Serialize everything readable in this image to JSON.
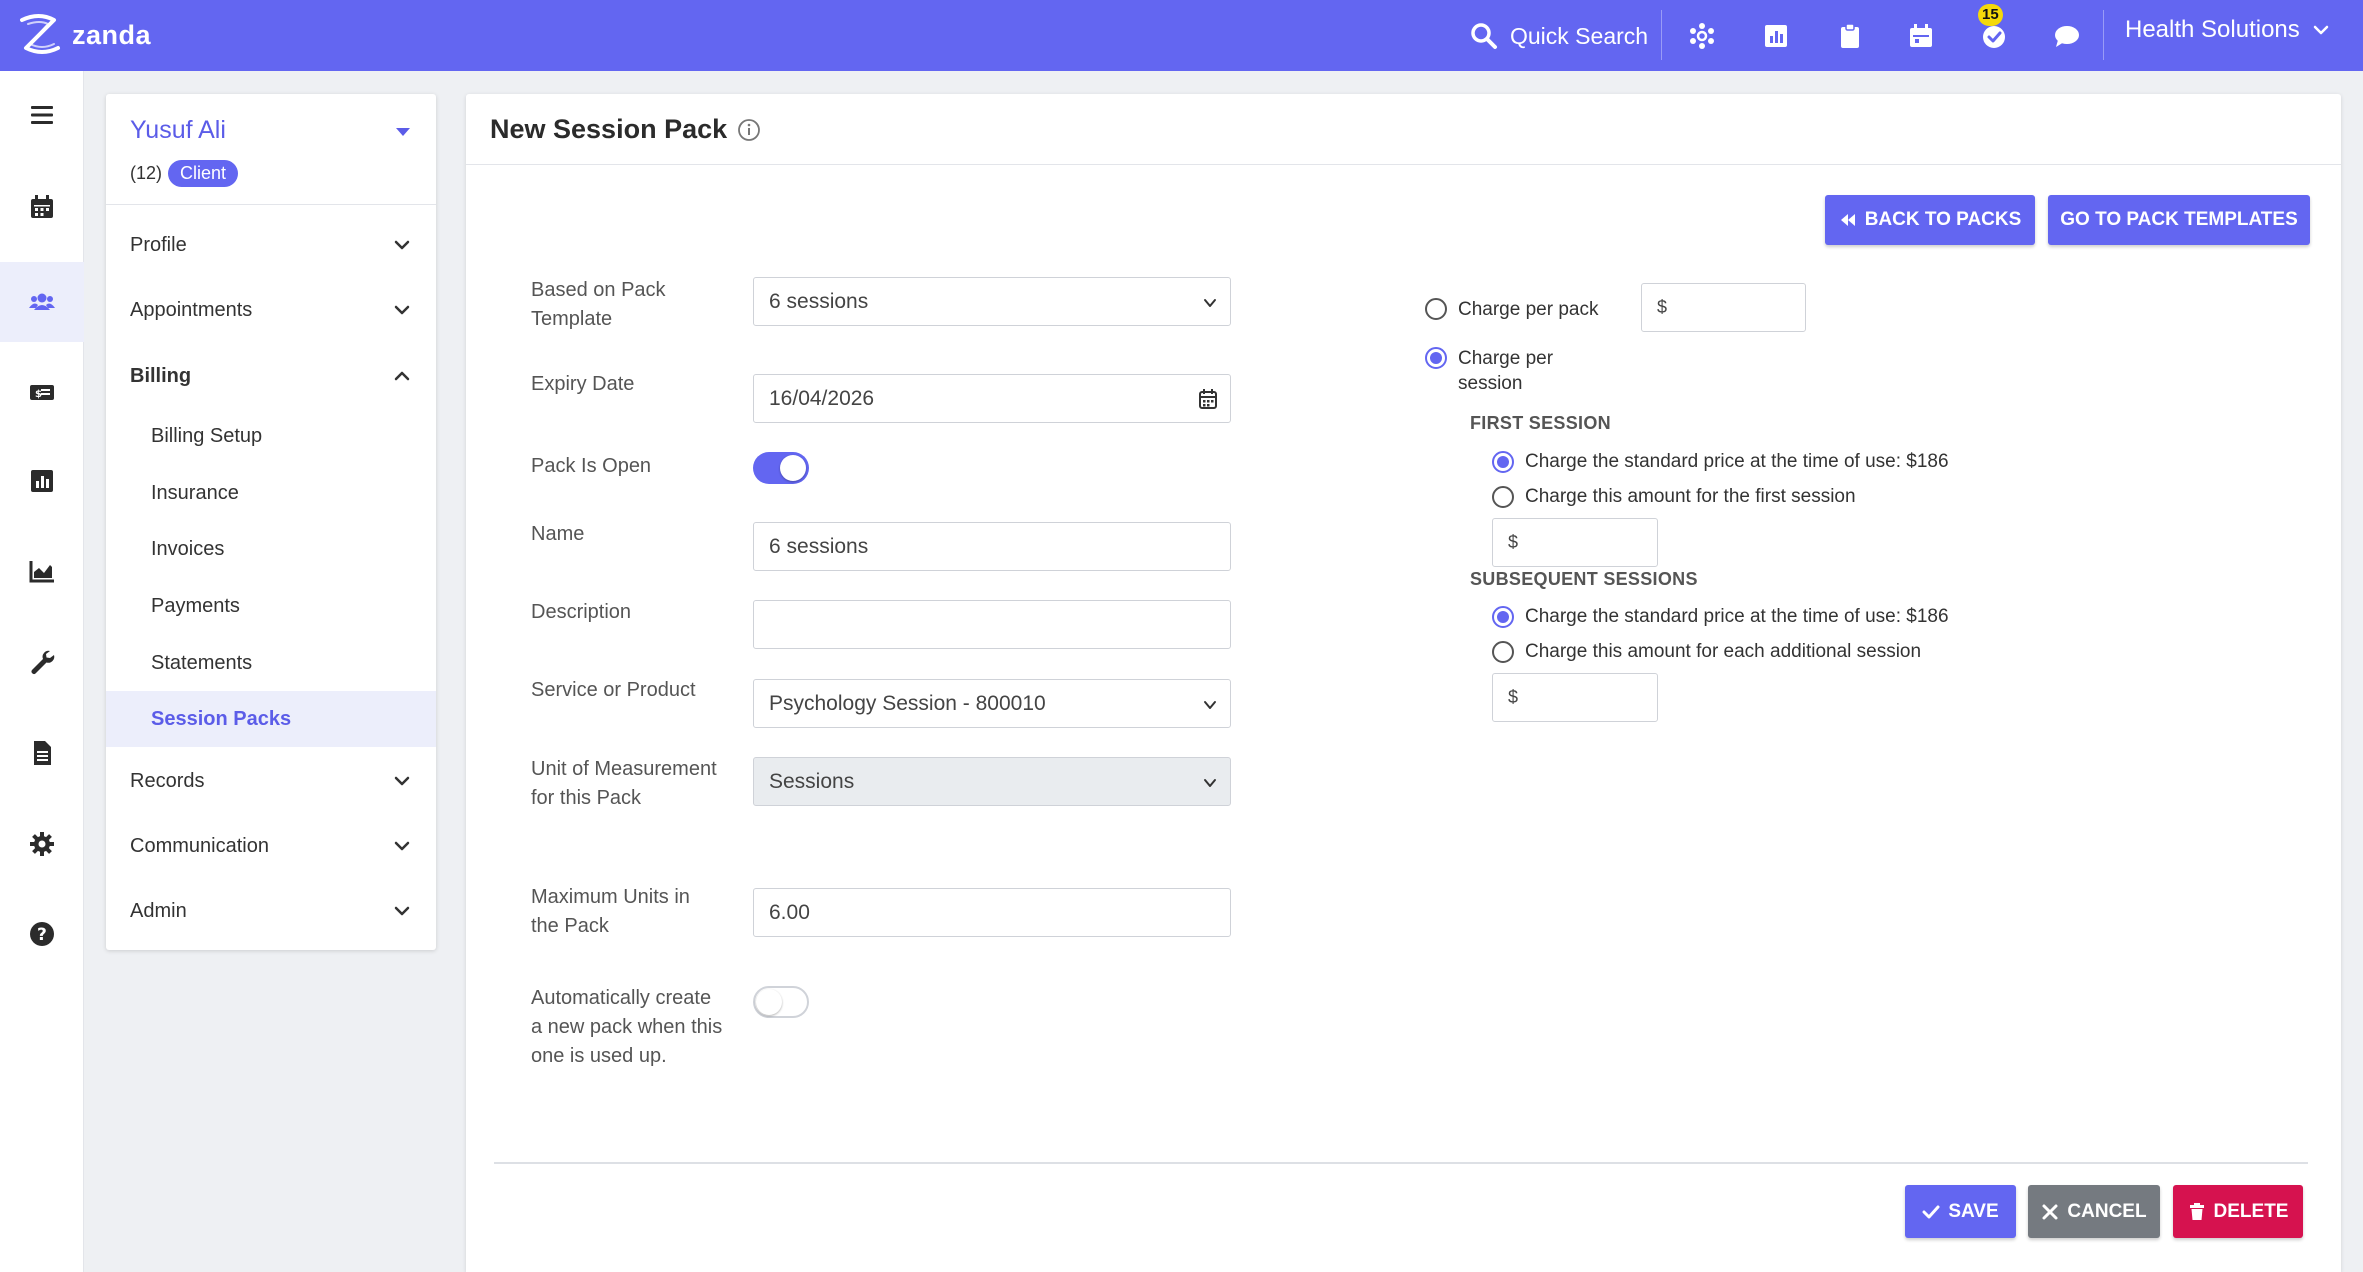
{
  "header": {
    "logo_text": "zanda",
    "quick_search": "Quick Search",
    "task_badge": "15",
    "org_name": "Health Solutions"
  },
  "client": {
    "name": "Yusuf Ali",
    "id": "(12)",
    "tag": "Client"
  },
  "subnav": {
    "profile": "Profile",
    "appointments": "Appointments",
    "billing": "Billing",
    "billing_items": [
      "Billing Setup",
      "Insurance",
      "Invoices",
      "Payments",
      "Statements",
      "Session Packs"
    ],
    "records": "Records",
    "communication": "Communication",
    "admin": "Admin"
  },
  "page": {
    "title": "New Session Pack",
    "back_to_packs": "BACK TO PACKS",
    "go_to_templates": "GO TO PACK TEMPLATES"
  },
  "form": {
    "template_label": "Based on Pack Template",
    "template_value": "6 sessions",
    "expiry_label": "Expiry Date",
    "expiry_value": "16/04/2026",
    "open_label": "Pack Is Open",
    "name_label": "Name",
    "name_value": "6 sessions",
    "description_label": "Description",
    "description_value": "",
    "service_label": "Service or Product",
    "service_value": "Psychology Session - 800010",
    "unit_label": "Unit of Measurement for this Pack",
    "unit_value": "Sessions",
    "max_units_label": "Maximum Units in the Pack",
    "max_units_value": "6.00",
    "auto_create_label": "Automatically create a new pack when this one is used up.",
    "pack_is_open": true,
    "auto_create": false
  },
  "pricing": {
    "charge_per_pack": "Charge per pack",
    "charge_per_session": "Charge per session",
    "currency_symbol": "$",
    "first_session_heading": "FIRST SESSION",
    "first_standard": "Charge the standard price at the time of use:",
    "first_standard_price": "$186",
    "first_custom": "Charge this amount for the first session",
    "subsequent_heading": "SUBSEQUENT SESSIONS",
    "subsequent_standard": "Charge the standard price at the time of use:",
    "subsequent_standard_price": "$186",
    "subsequent_custom": "Charge this amount for each additional session"
  },
  "actions": {
    "save": "SAVE",
    "cancel": "CANCEL",
    "delete": "DELETE"
  },
  "colors": {
    "brand": "#6366f1",
    "danger": "#d6124f",
    "neutral": "#757a80",
    "badge": "#f5d90a"
  }
}
